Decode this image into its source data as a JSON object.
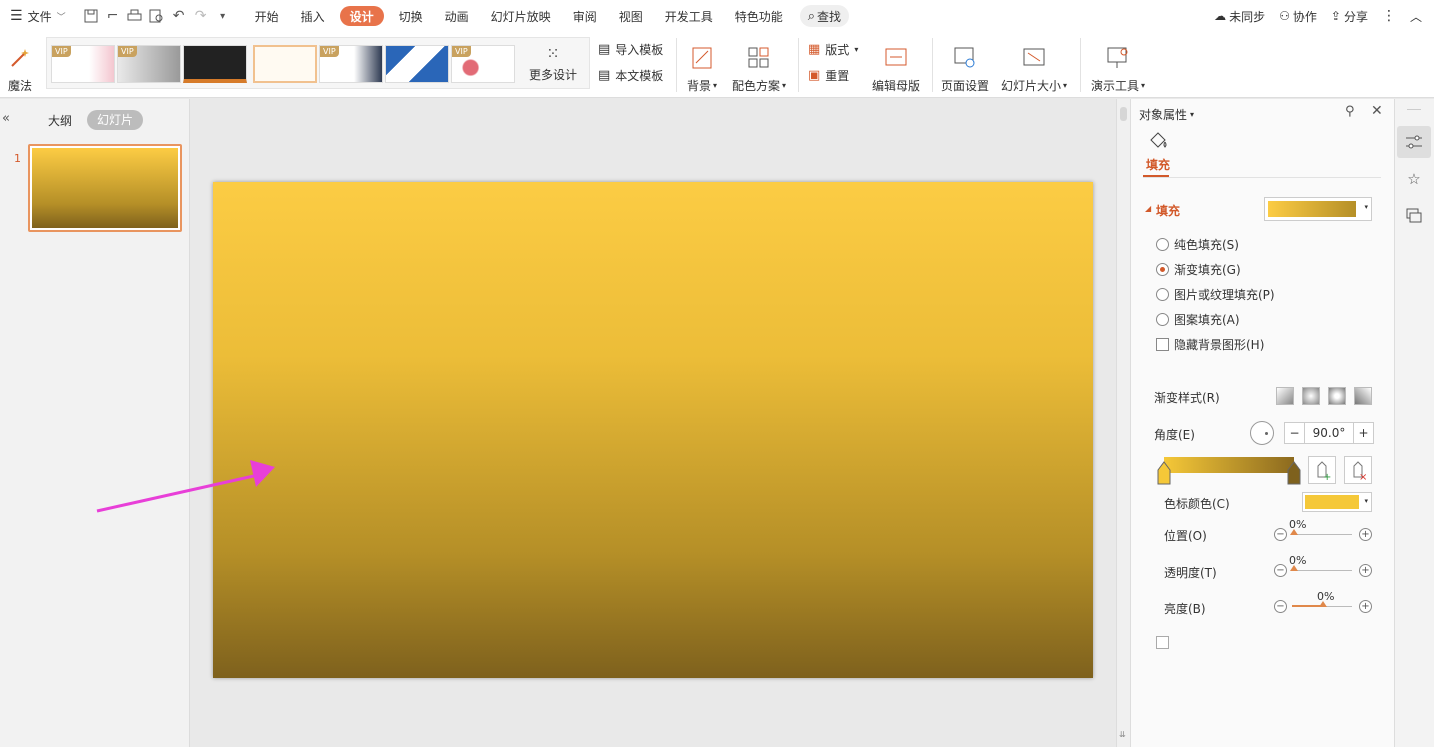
{
  "menu": {
    "file_label": "文件",
    "tabs": [
      "开始",
      "插入",
      "设计",
      "切换",
      "动画",
      "幻灯片放映",
      "审阅",
      "视图",
      "开发工具",
      "特色功能"
    ],
    "active_tab": "设计",
    "search_label": "查找",
    "sync_label": "未同步",
    "collab_label": "协作",
    "share_label": "分享"
  },
  "ribbon": {
    "magic_label": "魔法",
    "more_design_label": "更多设计",
    "vip_badge": "VIP",
    "import_template_label": "导入模板",
    "this_template_label": "本文模板",
    "background_label": "背景",
    "color_scheme_label": "配色方案",
    "layout_label": "版式",
    "reset_label": "重置",
    "edit_master_label": "编辑母版",
    "page_setup_label": "页面设置",
    "slide_size_label": "幻灯片大小",
    "present_tools_label": "演示工具"
  },
  "left_pane": {
    "outline_tab": "大纲",
    "slides_tab": "幻灯片",
    "slide_number": "1"
  },
  "right_pane": {
    "title": "对象属性",
    "fill_tab": "填充",
    "fill_section": "填充",
    "fill_options": [
      "纯色填充(S)",
      "渐变填充(G)",
      "图片或纹理填充(P)",
      "图案填充(A)"
    ],
    "selected_fill": "渐变填充(G)",
    "hide_bg_graphics": "隐藏背景图形(H)",
    "gradient_style_label": "渐变样式(R)",
    "angle_label": "角度(E)",
    "angle_value": "90.0°",
    "stop_color_label": "色标颜色(C)",
    "position_label": "位置(O)",
    "position_value": "0%",
    "transparency_label": "透明度(T)",
    "transparency_value": "0%",
    "brightness_label": "亮度(B)",
    "brightness_value": "0%",
    "stop_color": "#f5c838",
    "gradient_start": "#fccc44",
    "gradient_end": "#7e611d"
  },
  "annotation_arrow_color": "#e83fd8"
}
